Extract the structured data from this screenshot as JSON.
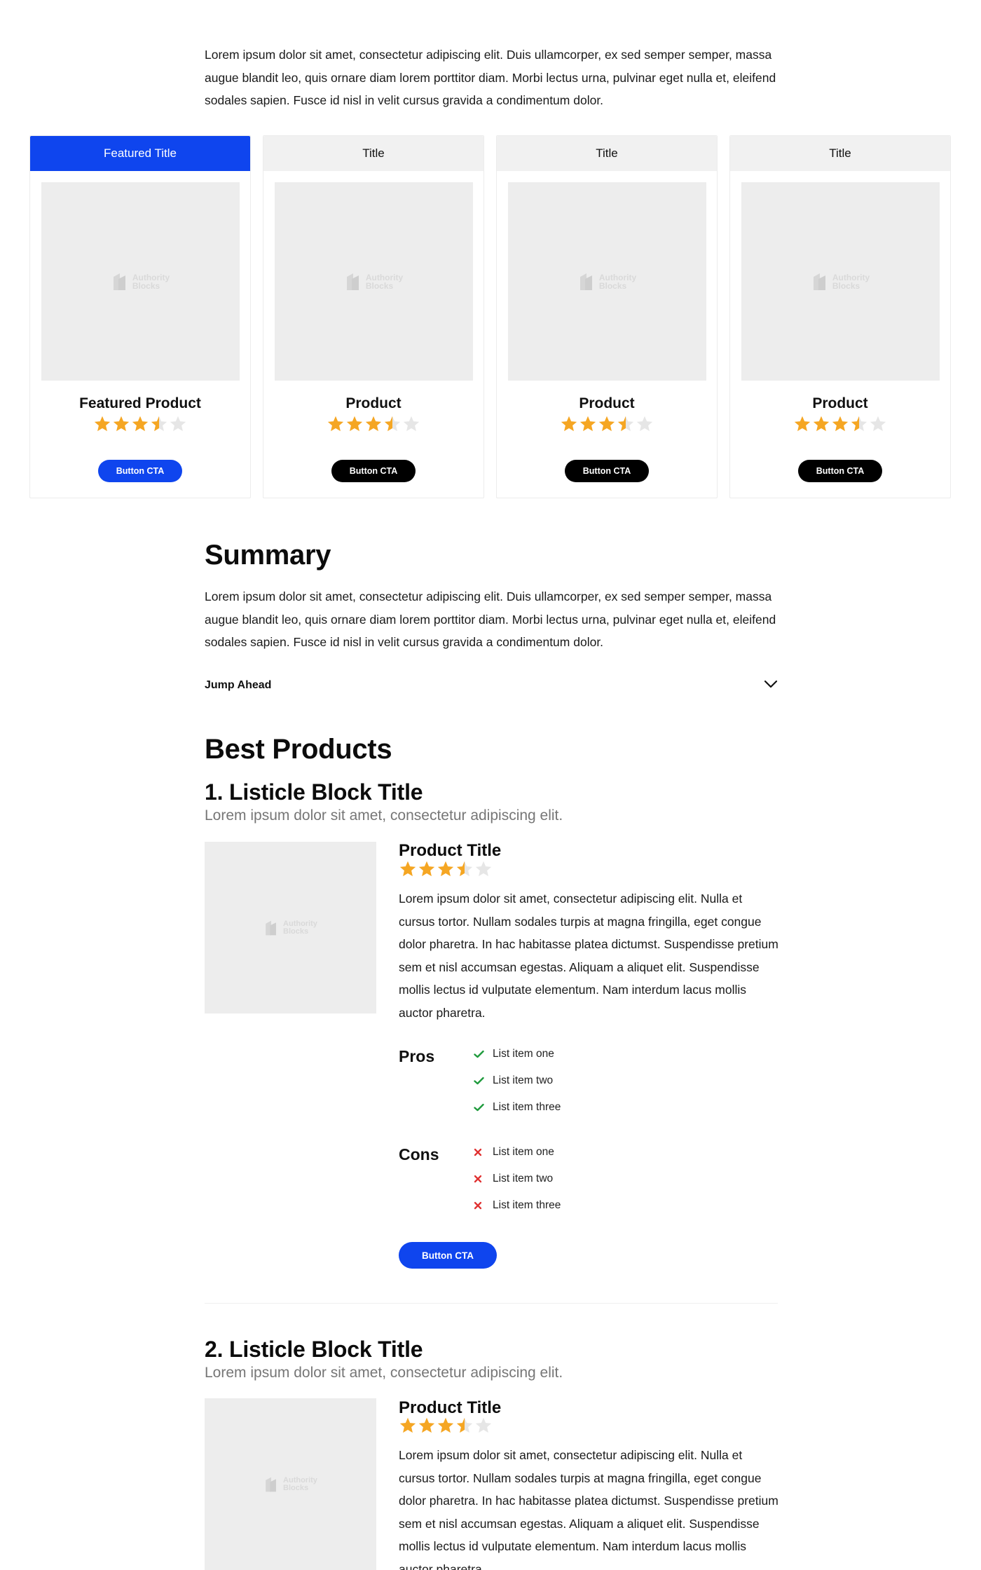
{
  "intro": "Lorem ipsum dolor sit amet, consectetur adipiscing elit. Duis ullamcorper, ex sed semper semper, massa augue blandit leo, quis ornare diam lorem porttitor diam. Morbi lectus urna, pulvinar eget nulla et, eleifend sodales sapien. Fusce id nisl in velit cursus gravida a condimentum dolor.",
  "placeholder_logo": {
    "line1": "Authority",
    "line2": "Blocks",
    "icon": "authority-blocks-logo"
  },
  "colors": {
    "accent": "#0f45ee",
    "star": "#f5a623",
    "star_empty": "#e6e6e6",
    "pro": "#1e9a3c",
    "con": "#e03131"
  },
  "cards": [
    {
      "title": "Featured Title",
      "product": "Featured Product",
      "rating": 3.5,
      "button": "Button CTA",
      "featured": true
    },
    {
      "title": "Title",
      "product": "Product",
      "rating": 3.5,
      "button": "Button CTA",
      "featured": false
    },
    {
      "title": "Title",
      "product": "Product",
      "rating": 3.5,
      "button": "Button CTA",
      "featured": false
    },
    {
      "title": "Title",
      "product": "Product",
      "rating": 3.5,
      "button": "Button CTA",
      "featured": false
    }
  ],
  "summary": {
    "title": "Summary",
    "text": "Lorem ipsum dolor sit amet, consectetur adipiscing elit. Duis ullamcorper, ex sed semper semper, massa augue blandit leo, quis ornare diam lorem porttitor diam. Morbi lectus urna, pulvinar eget nulla et, eleifend sodales sapien. Fusce id nisl in velit cursus gravida a condimentum dolor.",
    "jump_label": "Jump Ahead",
    "jump_icon": "chevron-down-icon"
  },
  "best": {
    "title": "Best Products"
  },
  "blocks": [
    {
      "title": "1. Listicle Block Title",
      "subtitle": "Lorem ipsum dolor sit amet, consectetur adipiscing elit.",
      "product_title": "Product Title",
      "rating": 3.5,
      "description": "Lorem ipsum dolor sit amet, consectetur adipiscing elit. Nulla et cursus tortor. Nullam sodales turpis at magna fringilla, eget congue dolor pharetra. In hac habitasse platea dictumst. Suspendisse pretium sem et nisl accumsan egestas. Aliquam a aliquet elit. Suspendisse mollis lectus id vulputate elementum. Nam interdum lacus mollis auctor pharetra.",
      "pros_label": "Pros",
      "pros": [
        "List item one",
        "List item two",
        "List item three"
      ],
      "cons_label": "Cons",
      "cons": [
        "List item one",
        "List item two",
        "List item three"
      ],
      "button": "Button CTA"
    },
    {
      "title": "2. Listicle Block Title",
      "subtitle": "Lorem ipsum dolor sit amet, consectetur adipiscing elit.",
      "product_title": "Product Title",
      "rating": 3.5,
      "description": "Lorem ipsum dolor sit amet, consectetur adipiscing elit. Nulla et cursus tortor. Nullam sodales turpis at magna fringilla, eget congue dolor pharetra. In hac habitasse platea dictumst. Suspendisse pretium sem et nisl accumsan egestas. Aliquam a aliquet elit. Suspendisse mollis lectus id vulputate elementum. Nam interdum lacus mollis auctor pharetra."
    }
  ]
}
